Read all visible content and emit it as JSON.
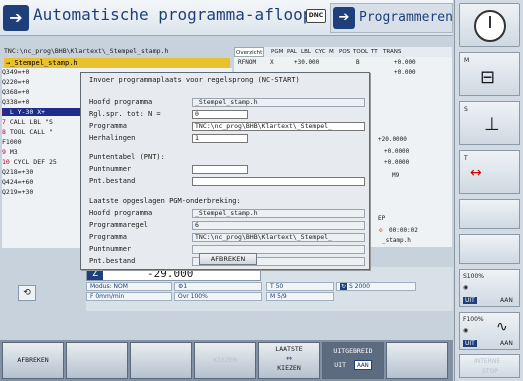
{
  "header": {
    "mode_title": "Automatische programma-afloop",
    "dnc_label": "DNC",
    "prog_mode_title": "Programmeren"
  },
  "program": {
    "path": "TNC:\\nc_prog\\BHB\\Klartext\\_Stempel_stamp.h",
    "file": "→_Stempel_stamp.h",
    "lines": [
      {
        "n": "",
        "t": "   Q349=+0"
      },
      {
        "n": "",
        "t": "   Q220=+0"
      },
      {
        "n": "",
        "t": "   Q368=+0"
      },
      {
        "n": "",
        "t": "   Q338=+0"
      },
      {
        "n": "6",
        "t": " L  Y-30  X+",
        "sel": true
      },
      {
        "n": "7",
        "t": " CALL LBL \"S"
      },
      {
        "n": "8",
        "t": " TOOL CALL \""
      },
      {
        "n": "",
        "t": "   F1000"
      },
      {
        "n": "9",
        "t": " M3"
      },
      {
        "n": "10",
        "t": " CYCL DEF 25"
      },
      {
        "n": "",
        "t": "   Q218=+30"
      },
      {
        "n": "",
        "t": "   Q424=+60"
      },
      {
        "n": "",
        "t": "   Q219=+30"
      }
    ]
  },
  "status_tabs": [
    "Overzicht",
    "PGM",
    "PAL",
    "LBL",
    "CYC",
    "M",
    "POS",
    "TOOL",
    "TT",
    "TRANS"
  ],
  "status_values": {
    "rfnom": "RFNOM",
    "x": "X",
    "x_val": "+30.000",
    "b": "B",
    "b_val": "+0.000",
    "c_val": "+0.000",
    "v1": "+20.0000",
    "v2": "+0.0000",
    "v3": "+0.0000",
    "m": "M9",
    "ep": "EP",
    "time": "00:00:02",
    "stamp": "_stamp.h"
  },
  "dialog": {
    "title": "Invoer programmaplaats voor regelsprong (NC-START)",
    "main_program_label": "Hoofd programma",
    "main_program_value": "_Stempel_stamp.h",
    "block_label": "Rgl.spr. tot: N =",
    "block_value": "0",
    "program_label": "Programma",
    "program_value": "TNC:\\nc_prog\\BHB\\Klartext\\_Stempel_",
    "repeats_label": "Herhalingen",
    "repeats_value": "1",
    "pnt_header": "Puntentabel (PNT):",
    "point_number_label": "Puntnummer",
    "pnt_file_label": "Pnt.bestand",
    "last_header": "Laatste opgeslagen PGM-onderbreking:",
    "last_main_label": "Hoofd programma",
    "last_main_value": "_Stempel_stamp.h",
    "last_block_label": "Programmaregel",
    "last_block_value": "6",
    "last_program_label": "Programma",
    "last_program_value": "TNC:\\nc_prog\\BHB\\Klartext\\_Stempel_",
    "last_point_label": "Puntnummer",
    "last_pnt_label": "Pnt.bestand",
    "cancel_button": "AFBREKEN"
  },
  "axis": {
    "name": "Z",
    "value": "-29.000",
    "mode": "Modus: NOM",
    "t": "T 50",
    "s": "S 2000",
    "feed": "F 0mm/min",
    "ovr": "Ovr 100%",
    "m": "M 5/9",
    "one": "1"
  },
  "right_col": {
    "m": "M",
    "s": "S",
    "t": "T",
    "s100": "S100%",
    "uit1": "UIT",
    "aan1": "AAN",
    "f100": "F100%",
    "uit2": "UIT",
    "aan2": "AAN",
    "interne": "INTERNE",
    "stop": "STOP"
  },
  "softkeys": {
    "afbreken": "AFBREKEN",
    "kiezen_dim": "KIEZEN",
    "laatste": "LAATSTE",
    "kiezen": "KIEZEN",
    "uitgebreid": "UITGEBREID",
    "uit": "UIT",
    "aan": "AAN"
  }
}
